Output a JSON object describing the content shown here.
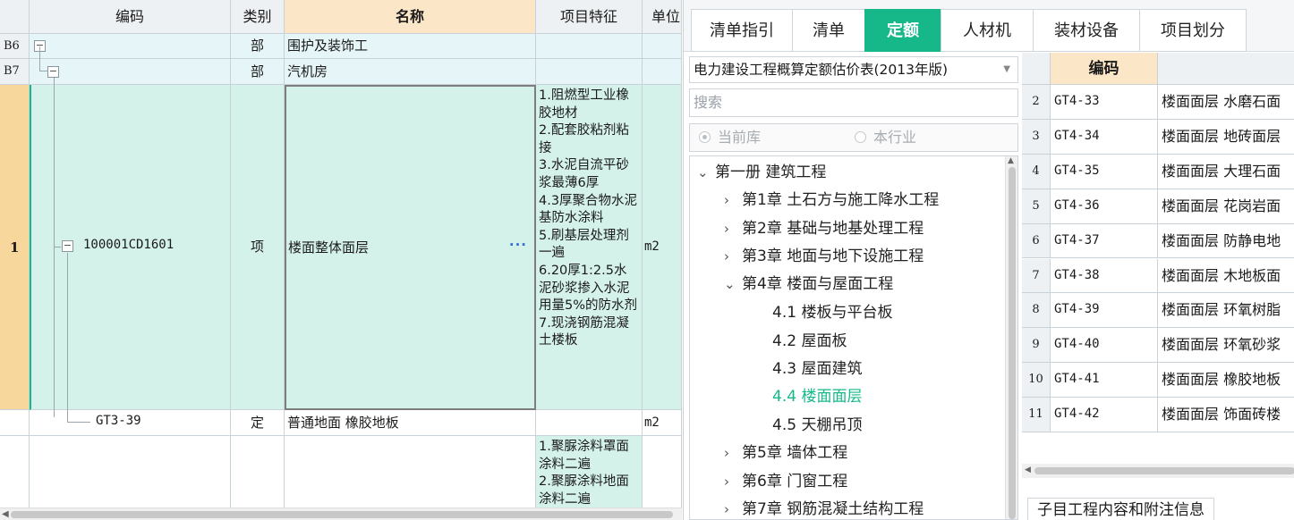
{
  "grid": {
    "columns": {
      "code": "编码",
      "type": "类别",
      "name": "名称",
      "feature": "项目特征",
      "unit": "单位"
    },
    "rows": [
      {
        "num": "B6",
        "code": "",
        "type": "部",
        "name": "围护及装饰工",
        "feature": "",
        "unit": "",
        "toggle": "−"
      },
      {
        "num": "B7",
        "code": "",
        "type": "部",
        "name": "汽机房",
        "feature": "",
        "unit": "",
        "toggle": "−"
      },
      {
        "num": "1",
        "code": "100001CD1601",
        "type": "项",
        "name": "楼面整体面层",
        "ellipsis": "···",
        "feature": "1.阻燃型工业橡胶地材\n2.配套胶粘剂粘接\n3.水泥自流平砂浆最薄6厚\n4.3厚聚合物水泥基防水涂料\n5.刷基层处理剂一遍\n6.20厚1:2.5水泥砂浆掺入水泥用量5%的防水剂\n7.现浇钢筋混凝土楼板",
        "unit": "m2",
        "toggle": "−"
      },
      {
        "num": "",
        "code": "GT3-39",
        "type": "定",
        "name": "普通地面 橡胶地板",
        "feature": "",
        "unit": "m2"
      },
      {
        "num": "",
        "code": "",
        "type": "",
        "name": "",
        "feature": "1.聚脲涂料罩面涂料二遍\n2.聚脲涂料地面涂料二遍",
        "unit": ""
      }
    ]
  },
  "tabs": [
    "清单指引",
    "清单",
    "定额",
    "人材机",
    "装材设备",
    "项目划分"
  ],
  "active_tab": "定额",
  "library": {
    "selected": "电力建设工程概算定额估价表(2013年版)"
  },
  "search": {
    "placeholder": "搜索"
  },
  "scope": {
    "option1": "当前库",
    "option2": "本行业",
    "selected": "当前库"
  },
  "tree": {
    "book": "第一册 建筑工程",
    "chapters": [
      {
        "label": "第1章 土石方与施工降水工程"
      },
      {
        "label": "第2章 基础与地基处理工程"
      },
      {
        "label": "第3章 地面与地下设施工程"
      },
      {
        "label": "第4章 楼面与屋面工程"
      },
      {
        "label": "第5章 墙体工程"
      },
      {
        "label": "第6章 门窗工程"
      },
      {
        "label": "第7章 钢筋混凝土结构工程"
      }
    ],
    "sections": [
      {
        "label": "4.1 楼板与平台板"
      },
      {
        "label": "4.2 屋面板"
      },
      {
        "label": "4.3 屋面建筑"
      },
      {
        "label": "4.4 楼面面层"
      },
      {
        "label": "4.5 天棚吊顶"
      }
    ],
    "selected_section": "4.4 楼面面层"
  },
  "quota_list": {
    "header_code": "编码",
    "rows": [
      {
        "num": "2",
        "code": "GT4-33",
        "name": "楼面面层 水磨石面"
      },
      {
        "num": "3",
        "code": "GT4-34",
        "name": "楼面面层 地砖面层"
      },
      {
        "num": "4",
        "code": "GT4-35",
        "name": "楼面面层 大理石面"
      },
      {
        "num": "5",
        "code": "GT4-36",
        "name": "楼面面层 花岗岩面"
      },
      {
        "num": "6",
        "code": "GT4-37",
        "name": "楼面面层 防静电地"
      },
      {
        "num": "7",
        "code": "GT4-38",
        "name": "楼面面层 木地板面"
      },
      {
        "num": "8",
        "code": "GT4-39",
        "name": "楼面面层 环氧树脂"
      },
      {
        "num": "9",
        "code": "GT4-40",
        "name": "楼面面层 环氧砂浆"
      },
      {
        "num": "10",
        "code": "GT4-41",
        "name": "楼面面层 橡胶地板"
      },
      {
        "num": "11",
        "code": "GT4-42",
        "name": "楼面面层 饰面砖楼"
      }
    ]
  },
  "sub_info_tab": "子目工程内容和附注信息",
  "colors": {
    "accent": "#16b88a",
    "header_highlight": "#fce6c8",
    "row_mint": "#d5f2ea",
    "row_lightblue": "#e6f5f8"
  }
}
